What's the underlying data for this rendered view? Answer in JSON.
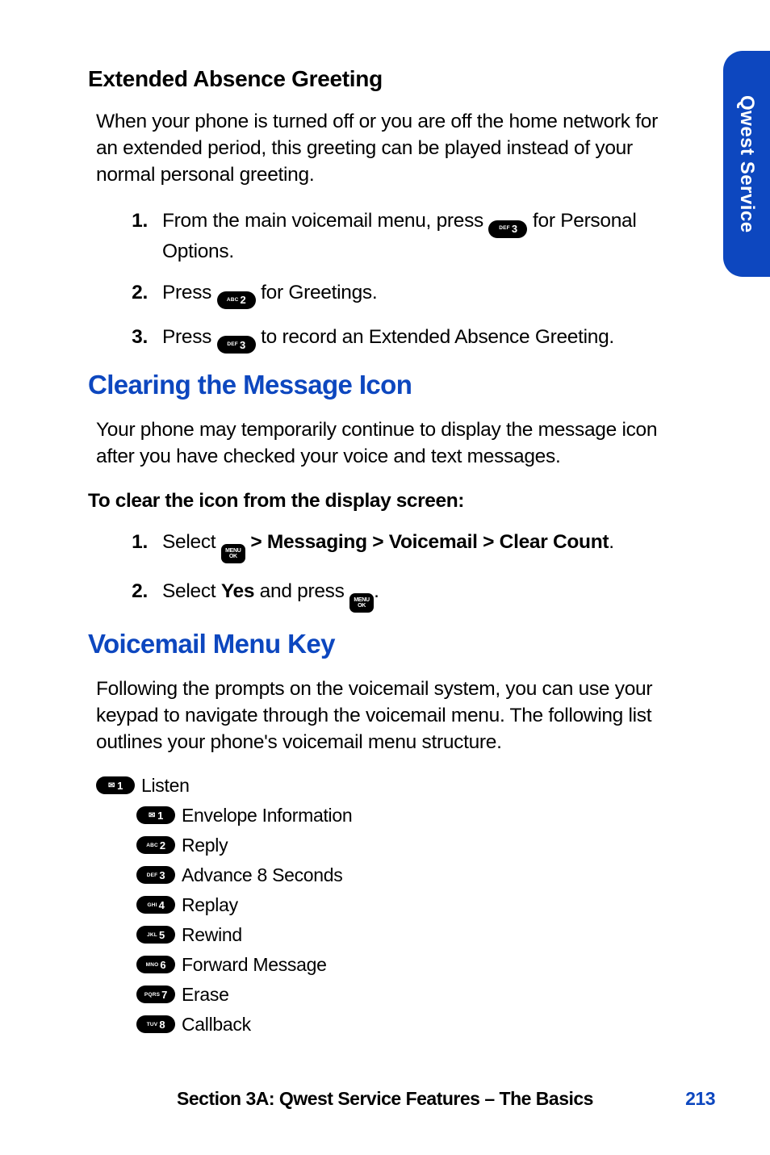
{
  "sideTab": "Qwest Service",
  "sections": {
    "extAbsence": {
      "title": "Extended Absence Greeting",
      "intro": "When your phone is turned off or you are off the home network for an extended period, this greeting can be played instead of your normal personal greeting.",
      "s1a": "From the main voicemail menu, press ",
      "s1b": " for Personal Options.",
      "s2a": "Press ",
      "s2b": " for Greetings.",
      "s3a": "Press ",
      "s3b": " to record an Extended Absence Greeting."
    },
    "clearIcon": {
      "title": "Clearing the Message Icon",
      "intro": "Your phone may temporarily continue to display the message icon after you have checked your voice and text messages.",
      "subhead": "To clear the icon from the display screen:",
      "s1a": "Select ",
      "s1b": " > Messaging > Voicemail > Clear Count",
      "s1c": ".",
      "s2a": "Select ",
      "s2b": "Yes",
      "s2c": " and press ",
      "s2d": "."
    },
    "vmMenu": {
      "title": "Voicemail Menu Key",
      "intro": "Following the prompts on the voicemail system, you can use your keypad to navigate through the voicemail menu. The following list outlines your phone's voicemail menu structure.",
      "root": "Listen",
      "items": {
        "i1": "Envelope Information",
        "i2": "Reply",
        "i3": "Advance 8 Seconds",
        "i4": "Replay",
        "i5": "Rewind",
        "i6": "Forward Message",
        "i7": "Erase",
        "i8": "Callback"
      }
    }
  },
  "keys": {
    "abc2": {
      "small": "ABC",
      "big": "2"
    },
    "def3": {
      "small": "DEF",
      "big": "3"
    },
    "ghi4": {
      "small": "GHI",
      "big": "4"
    },
    "jkl5": {
      "small": "JKL",
      "big": "5"
    },
    "mno6": {
      "small": "MNO",
      "big": "6"
    },
    "pqrs7": {
      "small": "PQRS",
      "big": "7"
    },
    "tuv8": {
      "small": "TUV",
      "big": "8"
    },
    "env1": {
      "big": "1"
    },
    "menu": {
      "l1": "MENU",
      "l2": "OK"
    }
  },
  "footer": {
    "text": "Section 3A: Qwest Service Features – The Basics",
    "page": "213"
  }
}
